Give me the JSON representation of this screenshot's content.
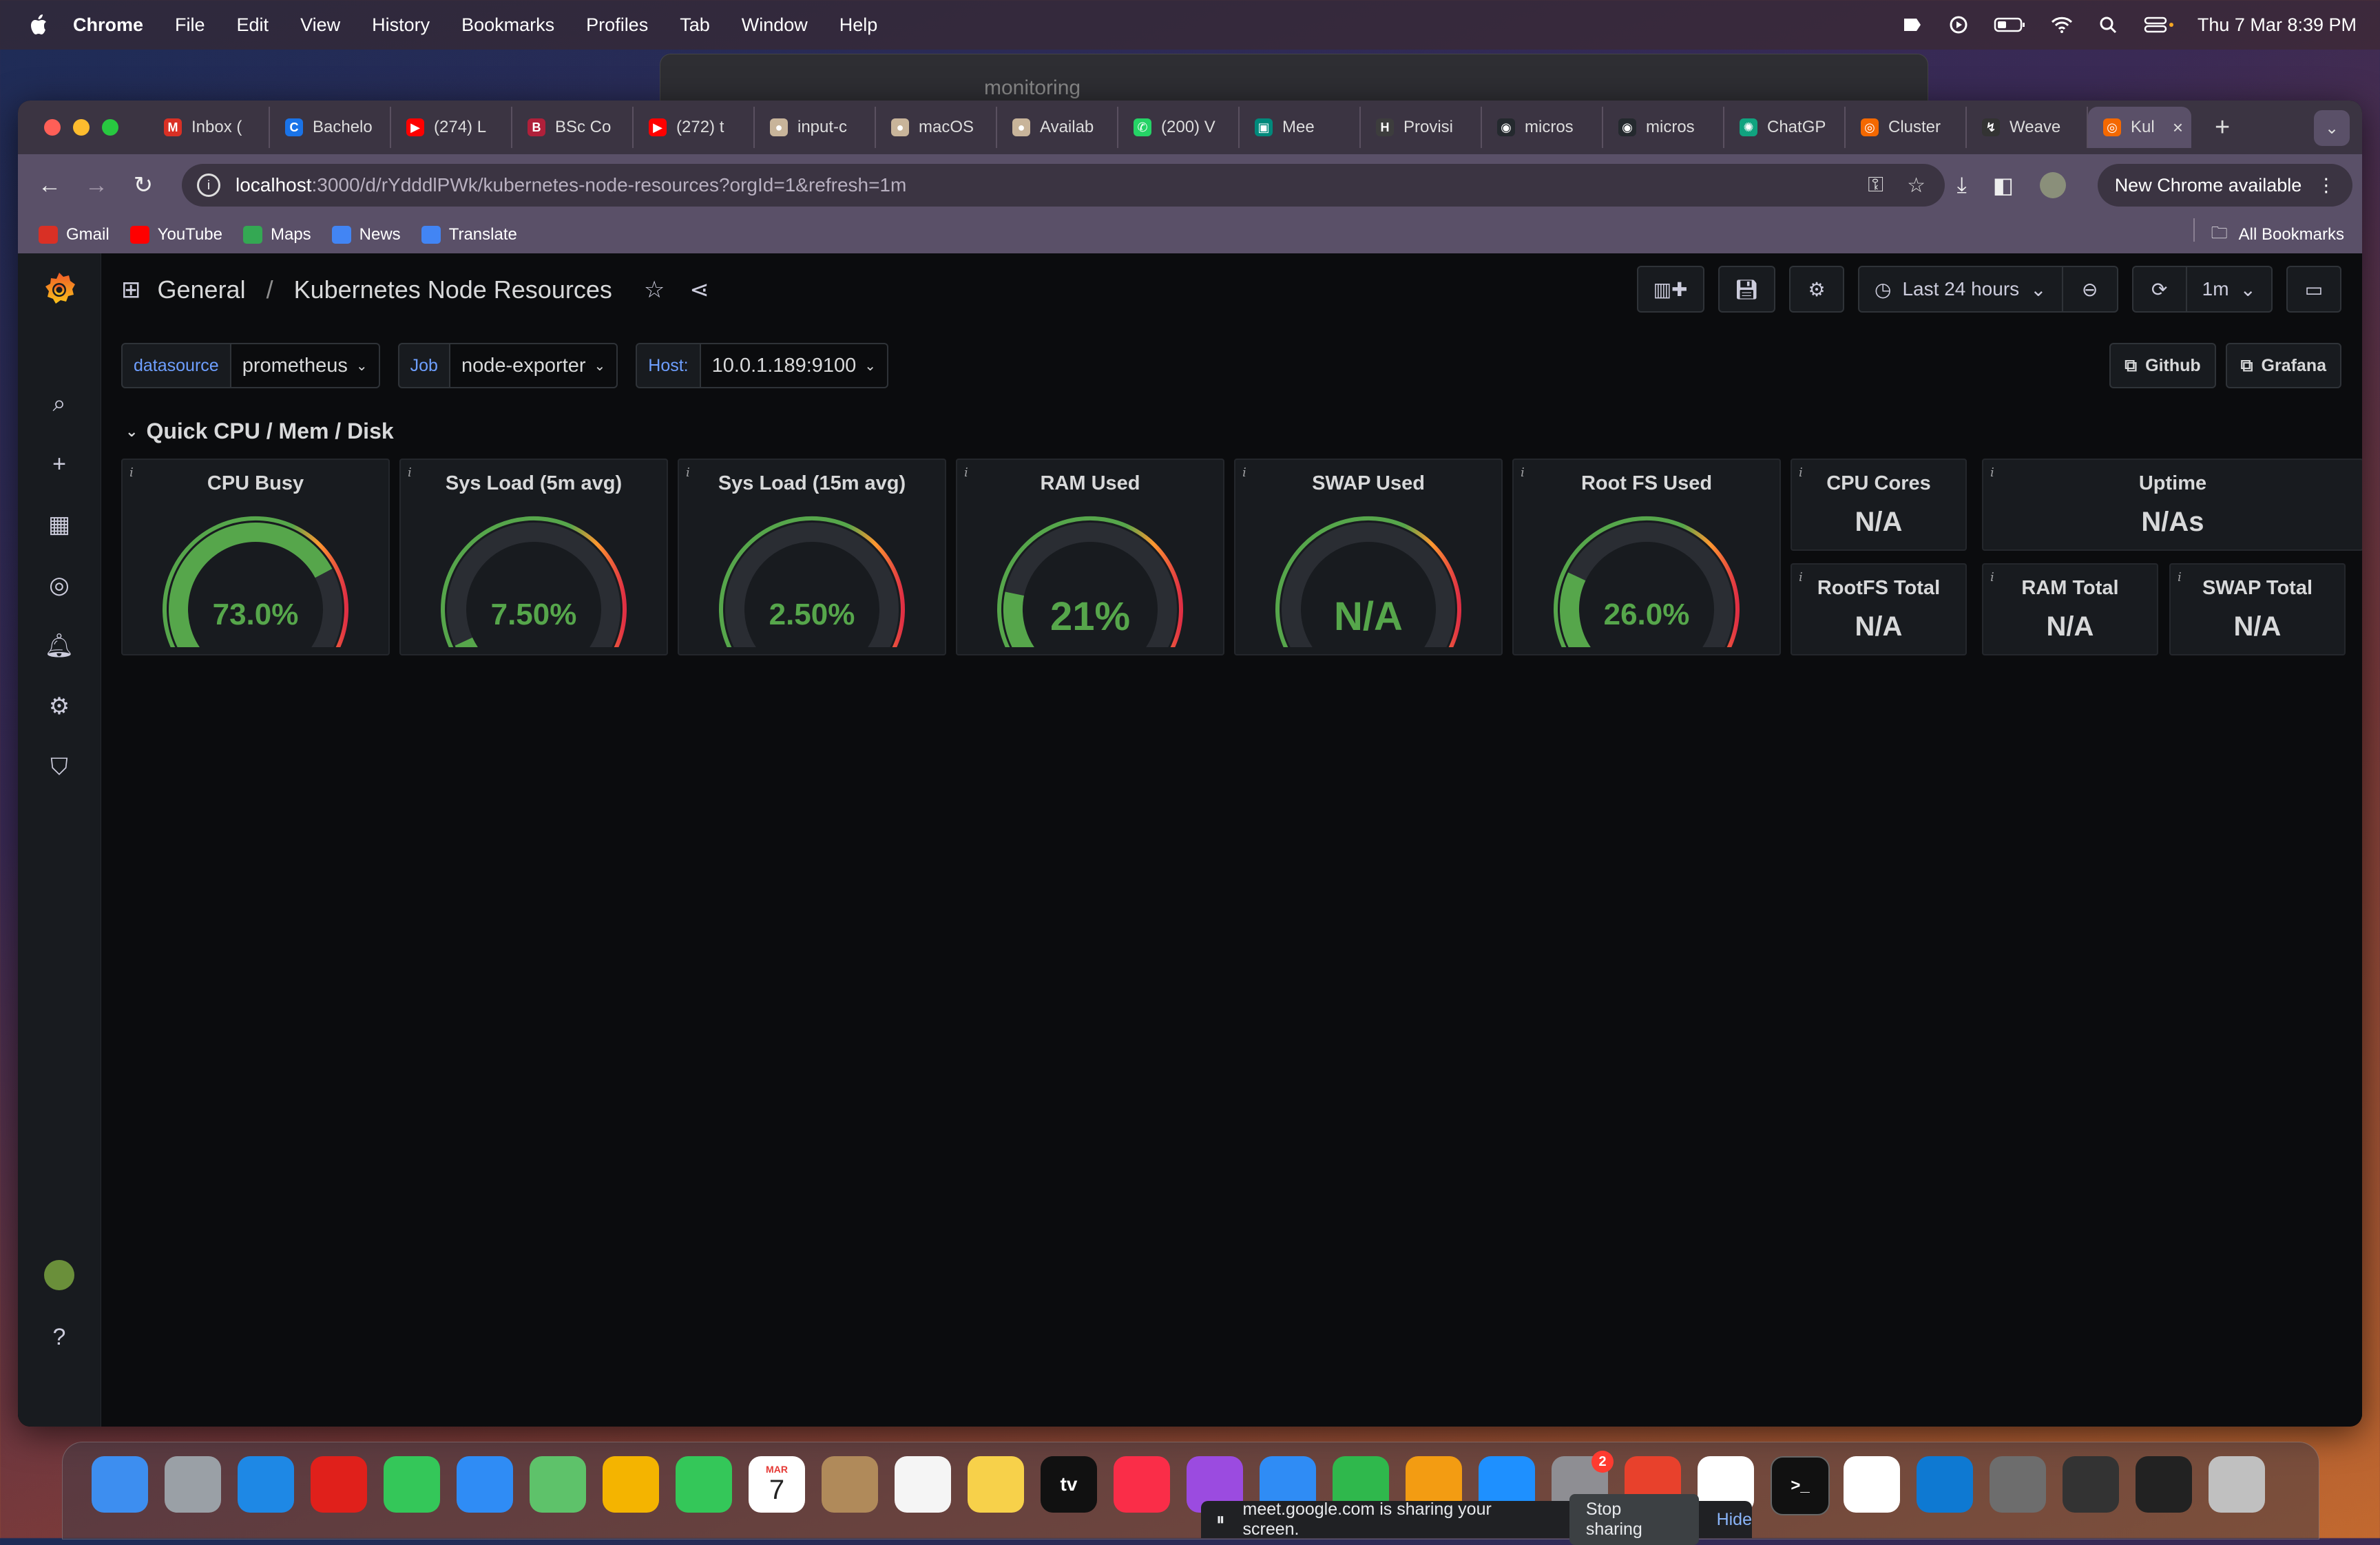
{
  "menubar": {
    "app": "Chrome",
    "items": [
      "File",
      "Edit",
      "View",
      "History",
      "Bookmarks",
      "Profiles",
      "Tab",
      "Window",
      "Help"
    ],
    "clock": "Thu 7 Mar  8:39 PM"
  },
  "background_window": {
    "title": "monitoring"
  },
  "browser": {
    "tabs": [
      {
        "label": "Inbox (",
        "color": "#d93025",
        "glyph": "M"
      },
      {
        "label": "Bachelo",
        "color": "#1a73e8",
        "glyph": "C"
      },
      {
        "label": "(274) L",
        "color": "#ff0000",
        "glyph": "▶"
      },
      {
        "label": "BSc Co",
        "color": "#b0203a",
        "glyph": "B"
      },
      {
        "label": "(272) t",
        "color": "#ff0000",
        "glyph": "▶"
      },
      {
        "label": "input-c",
        "color": "#c8b49a",
        "glyph": "●"
      },
      {
        "label": "macOS",
        "color": "#c8b49a",
        "glyph": "●"
      },
      {
        "label": "Availab",
        "color": "#c8b49a",
        "glyph": "●"
      },
      {
        "label": "(200) V",
        "color": "#25d366",
        "glyph": "✆"
      },
      {
        "label": "Mee",
        "color": "#00897b",
        "glyph": "▣"
      },
      {
        "label": "Provisi",
        "color": "#3d3d3d",
        "glyph": "H"
      },
      {
        "label": "micros",
        "color": "#24292e",
        "glyph": "◉"
      },
      {
        "label": "micros",
        "color": "#24292e",
        "glyph": "◉"
      },
      {
        "label": "ChatGP",
        "color": "#10a37f",
        "glyph": "✺"
      },
      {
        "label": "Cluster",
        "color": "#f46800",
        "glyph": "◎"
      },
      {
        "label": "Weave",
        "color": "#333333",
        "glyph": "↯"
      }
    ],
    "active_tab": {
      "label": "Kul",
      "close": "×"
    },
    "new_tab": "+",
    "url_host": "localhost",
    "url_path": ":3000/d/rYdddlPWk/kubernetes-node-resources?orgId=1&refresh=1m",
    "update_label": "New Chrome available",
    "bookmarks": [
      {
        "label": "Gmail",
        "color": "#d93025"
      },
      {
        "label": "YouTube",
        "color": "#ff0000"
      },
      {
        "label": "Maps",
        "color": "#34a853"
      },
      {
        "label": "News",
        "color": "#4285f4"
      },
      {
        "label": "Translate",
        "color": "#4285f4"
      }
    ],
    "all_bookmarks": "All Bookmarks"
  },
  "grafana": {
    "breadcrumb": {
      "folder": "General",
      "separator": "/",
      "dashboard": "Kubernetes Node Resources"
    },
    "time_range": "Last 24 hours",
    "refresh_interval": "1m",
    "variables": [
      {
        "label": "datasource",
        "value": "prometheus"
      },
      {
        "label": "Job",
        "value": "node-exporter"
      },
      {
        "label": "Host:",
        "value": "10.0.1.189:9100"
      }
    ],
    "links": [
      {
        "label": "Github"
      },
      {
        "label": "Grafana"
      }
    ],
    "row_title": "Quick CPU / Mem / Disk",
    "gauges": [
      {
        "title": "CPU Busy",
        "display": "73.0%",
        "value": 73.0,
        "color": "#56a64b"
      },
      {
        "title": "Sys Load (5m avg)",
        "display": "7.50%",
        "value": 7.5,
        "color": "#56a64b"
      },
      {
        "title": "Sys Load (15m avg)",
        "display": "2.50%",
        "value": 2.5,
        "color": "#56a64b"
      },
      {
        "title": "RAM Used",
        "display": "21%",
        "value": 21,
        "color": "#56a64b"
      },
      {
        "title": "SWAP Used",
        "display": "N/A",
        "value": 0,
        "color": "#56a64b"
      },
      {
        "title": "Root FS Used",
        "display": "26.0%",
        "value": 26.0,
        "color": "#56a64b"
      }
    ],
    "stats": [
      {
        "title": "CPU Cores",
        "value": "N/A"
      },
      {
        "title": "Uptime",
        "value": "N/As"
      },
      {
        "title": "RootFS Total",
        "value": "N/A"
      },
      {
        "title": "RAM Total",
        "value": "N/A"
      },
      {
        "title": "SWAP Total",
        "value": "N/A"
      }
    ],
    "info_mark": "i"
  },
  "share_bar": {
    "message": "meet.google.com is sharing your screen.",
    "stop": "Stop sharing",
    "hide": "Hide"
  },
  "dock": {
    "calendar_month": "MAR",
    "calendar_day": "7",
    "settings_badge": "2",
    "tv_label": "tv"
  }
}
